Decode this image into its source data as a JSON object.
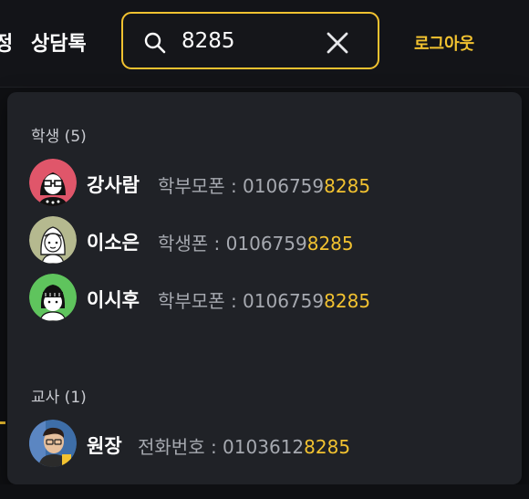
{
  "header": {
    "nav_partial": "정",
    "nav_chat": "상담톡",
    "logout_label": "로그아웃"
  },
  "search": {
    "value": "8285",
    "icon": "search-icon",
    "clear_icon": "close-icon"
  },
  "results": {
    "students": {
      "title": "학생 (5)",
      "items": [
        {
          "name": "강사람",
          "detail_prefix": "학부모폰 : 0106759",
          "detail_match": "8285",
          "avatar": "avatar-red-glasses"
        },
        {
          "name": "이소은",
          "detail_prefix": "학생폰 : 0106759",
          "detail_match": "8285",
          "avatar": "avatar-sage-girl"
        },
        {
          "name": "이시후",
          "detail_prefix": "학부모폰 : 0106759",
          "detail_match": "8285",
          "avatar": "avatar-green-bangs"
        }
      ]
    },
    "teachers": {
      "title": "교사 (1)",
      "items": [
        {
          "name": "원장",
          "detail_prefix": "전화번호 : 0103612",
          "detail_match": "8285",
          "avatar": "avatar-photo"
        }
      ]
    }
  },
  "colors": {
    "accent": "#f2c230",
    "panel": "#202227",
    "background": "#0f1013"
  }
}
